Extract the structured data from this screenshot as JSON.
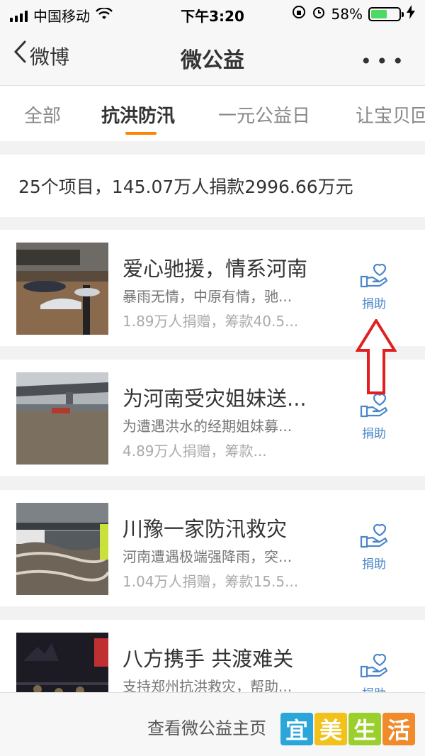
{
  "status": {
    "carrier": "中国移动",
    "time": "下午3:20",
    "battery": "58%",
    "battery_level": 0.58
  },
  "nav": {
    "back_label": "微博",
    "title": "微公益",
    "more": "•••"
  },
  "tabs": [
    {
      "label": "全部"
    },
    {
      "label": "抗洪防汛"
    },
    {
      "label": "一元公益日"
    },
    {
      "label": "让宝贝回"
    }
  ],
  "summary": "25个项目，145.07万人捐款2996.66万元",
  "projects": [
    {
      "title": "爱心驰援，情系河南",
      "desc": "暴雨无情，中原有情，驰...",
      "stat": "1.89万人捐赠，筹款40.5...",
      "action": "捐助"
    },
    {
      "title": "为河南受灾姐妹送...",
      "desc": "为遭遇洪水的经期姐妹募...",
      "stat": "4.89万人捐赠，筹款...",
      "action": "捐助"
    },
    {
      "title": "川豫一家防汛救灾",
      "desc": "河南遭遇极端强降雨，突...",
      "stat": "1.04万人捐赠，筹款15.5...",
      "action": "捐助"
    },
    {
      "title": "八方携手 共渡难关",
      "desc": "支持郑州抗洪救灾，帮助...",
      "stat": "",
      "action": "捐助"
    }
  ],
  "footer": {
    "link": "查看微公益主页"
  },
  "watermark": [
    "宜",
    "美",
    "生",
    "活"
  ],
  "colors": {
    "accent": "#ff8200",
    "donate_blue": "#4a86c9",
    "annotation_red": "#e02020"
  }
}
